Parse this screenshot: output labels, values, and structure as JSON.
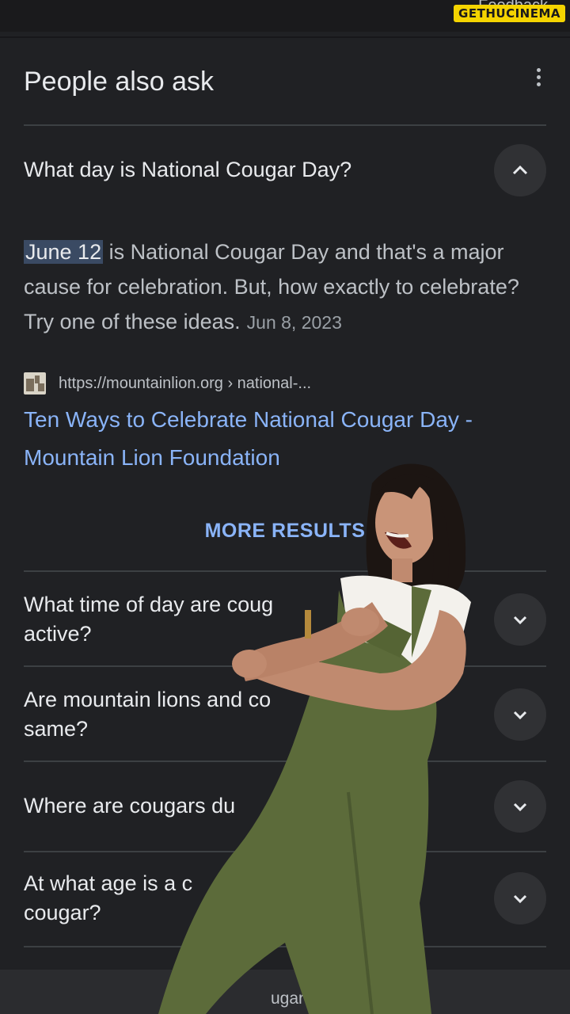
{
  "header": {
    "feedback_label": "Feedback",
    "watermark": "GETHUCINEMA"
  },
  "paa": {
    "title": "People also ask",
    "expanded": {
      "question": "What day is National Cougar Day?",
      "answer_highlight": "June 12",
      "answer_rest": " is National Cougar Day and that's a major cause for celebration. But, how exactly to celebrate? Try one of these ideas.",
      "date": "Jun 8, 2023",
      "source_url": "https://mountainlion.org › national-...",
      "link_title": "Ten Ways to Celebrate National Cougar Day - Mountain Lion Foundation"
    },
    "more_results_label": "MORE RESULTS",
    "questions": [
      {
        "visible_text": "What time of day are coug",
        "line2": "active?"
      },
      {
        "visible_text": "Are mountain lions and co",
        "line2": "same?"
      },
      {
        "visible_text": "Where are cougars du",
        "line2": ""
      },
      {
        "visible_text": "At what age is a c",
        "line2": "cougar?"
      }
    ]
  },
  "bottom_bar": {
    "partial_text": "ugar"
  },
  "colors": {
    "background": "#202124",
    "link": "#8ab4f8",
    "highlight": "#3a4a63",
    "overall_outfit": "#5c6b3a"
  }
}
